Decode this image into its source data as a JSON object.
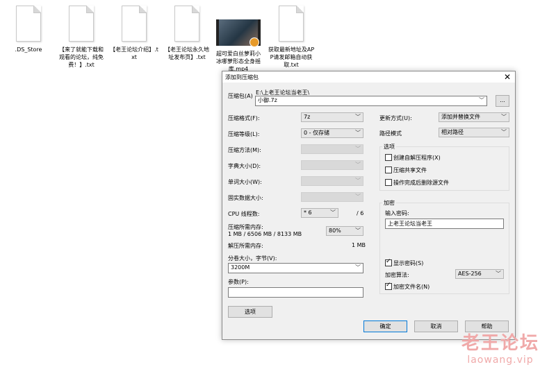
{
  "desktop": {
    "files": [
      {
        "name": ".DS_Store",
        "type": "doc"
      },
      {
        "name": "【来了就能下载和观看的论坛，纯免费！】.txt",
        "type": "doc"
      },
      {
        "name": "【老王论坛介绍】.txt",
        "type": "doc"
      },
      {
        "name": "【老王论坛永久地址发布页】.txt",
        "type": "doc"
      },
      {
        "name": "超可爱白丝萝莉小冰哪萝形态全身摇库.mp4",
        "type": "video"
      },
      {
        "name": "获取最新地址及APP请发邮箱自动获取.txt",
        "type": "doc"
      }
    ]
  },
  "dialog": {
    "title": "添加到压缩包",
    "close_glyph": "✕",
    "archive": {
      "label": "压缩包(A)",
      "path": "E:\\上老王论坛当老王\\",
      "filename": "小御.7z",
      "browse_label": "..."
    },
    "left": {
      "format": {
        "label": "压缩格式(F):",
        "value": "7z"
      },
      "level": {
        "label": "压缩等级(L):",
        "value": "0 - 仅存储"
      },
      "method": {
        "label": "压缩方法(M):",
        "value": ""
      },
      "dict": {
        "label": "字典大小(D):",
        "value": ""
      },
      "word": {
        "label": "单词大小(W):",
        "value": ""
      },
      "solid": {
        "label": "固实数据大小:",
        "value": ""
      },
      "cpu": {
        "label": "CPU 线程数:",
        "value": "* 6",
        "max": "/ 6"
      },
      "mem_compress": {
        "label": "压缩所需内存:",
        "detail": "1 MB / 6506 MB / 8133 MB",
        "percent": "80%"
      },
      "mem_decompress": {
        "label": "解压所需内存:",
        "value": "1 MB"
      },
      "volume": {
        "label": "分卷大小，字节(V):",
        "value": "3200M"
      },
      "params": {
        "label": "参数(P):",
        "value": ""
      },
      "options_button": "选项"
    },
    "right": {
      "update_mode": {
        "label": "更新方式(U):",
        "value": "添加并替换文件"
      },
      "path_mode": {
        "label": "路径模式",
        "value": "相对路径"
      },
      "options_group": {
        "title": "选项",
        "items": [
          {
            "label": "创建自解压程序(X)",
            "checked": false
          },
          {
            "label": "压缩共享文件",
            "checked": false
          },
          {
            "label": "操作完成后删除源文件",
            "checked": false
          }
        ]
      },
      "encryption_group": {
        "title": "加密",
        "password_label": "输入密码:",
        "password_value": "上老王论坛当老王",
        "show_password": {
          "label": "显示密码(S)",
          "checked": true
        },
        "method_label": "加密算法:",
        "method_value": "AES-256",
        "encrypt_names": {
          "label": "加密文件名(N)",
          "checked": true
        }
      }
    },
    "buttons": {
      "ok": "确定",
      "cancel": "取消",
      "help": "帮助"
    }
  },
  "watermark": {
    "line1": "老王论坛",
    "line2": "laowang.vip"
  }
}
